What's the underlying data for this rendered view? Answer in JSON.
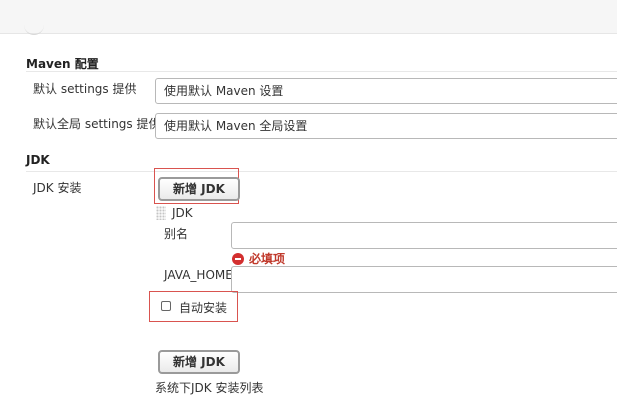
{
  "maven": {
    "section_title": "Maven 配置",
    "default_settings_label": "默认 settings 提供",
    "default_settings_value": "使用默认 Maven 设置",
    "global_settings_label": "默认全局 settings 提供",
    "global_settings_value": "使用默认 Maven 全局设置"
  },
  "jdk": {
    "section_title": "JDK",
    "install_label": "JDK 安装",
    "add_button_label": "新增 JDK",
    "block_title": "JDK",
    "alias_label": "别名",
    "alias_value": "",
    "required_text": "必填项",
    "java_home_label": "JAVA_HOME",
    "java_home_value": "",
    "auto_install_label": "自动安装",
    "auto_install_checked": false,
    "add_button_bottom_label": "新增 JDK",
    "system_list_text": "系统下JDK 安装列表"
  },
  "colors": {
    "highlight_border": "#d9534f",
    "error_text": "#c0392b"
  }
}
